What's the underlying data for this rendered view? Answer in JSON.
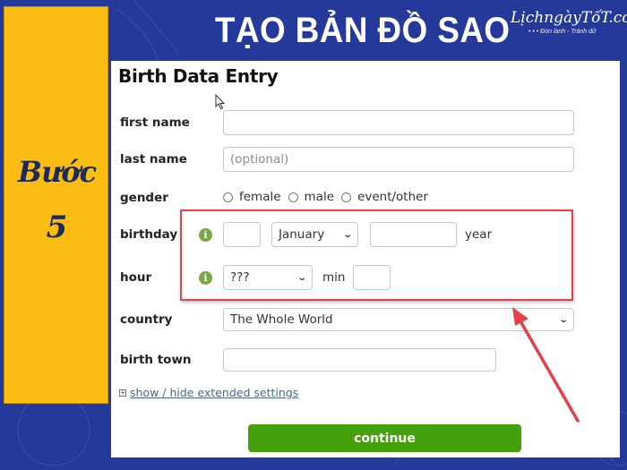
{
  "banner": {
    "title": "TẠO BẢN ĐỒ SAO",
    "logo_main": "LịchngàyTốT.com",
    "logo_tagline": "• • •  Đón lành - Tránh dữ"
  },
  "side_panel": {
    "step_word": "Bước",
    "step_number": "5"
  },
  "form": {
    "title": "Birth Data Entry",
    "first_name": {
      "label": "first name",
      "value": "",
      "placeholder": ""
    },
    "last_name": {
      "label": "last name",
      "value": "",
      "placeholder": "(optional)"
    },
    "gender": {
      "label": "gender",
      "options": [
        "female",
        "male",
        "event/other"
      ],
      "selected": null
    },
    "birthday": {
      "label": "birthday",
      "day_value": "",
      "month_selected": "January",
      "year_value": "",
      "year_label": "year"
    },
    "hour": {
      "label": "hour",
      "hour_selected": "???",
      "min_label": "min",
      "min_value": ""
    },
    "country": {
      "label": "country",
      "selected": "The Whole World"
    },
    "birth_town": {
      "label": "birth town",
      "value": ""
    },
    "extended_settings_link": "show / hide extended settings",
    "continue_label": "continue"
  },
  "colors": {
    "background": "#24399a",
    "side_panel": "#fbbd14",
    "highlight": "#e3404a",
    "continue_button": "#46a00b",
    "info_icon": "#7aa545"
  }
}
